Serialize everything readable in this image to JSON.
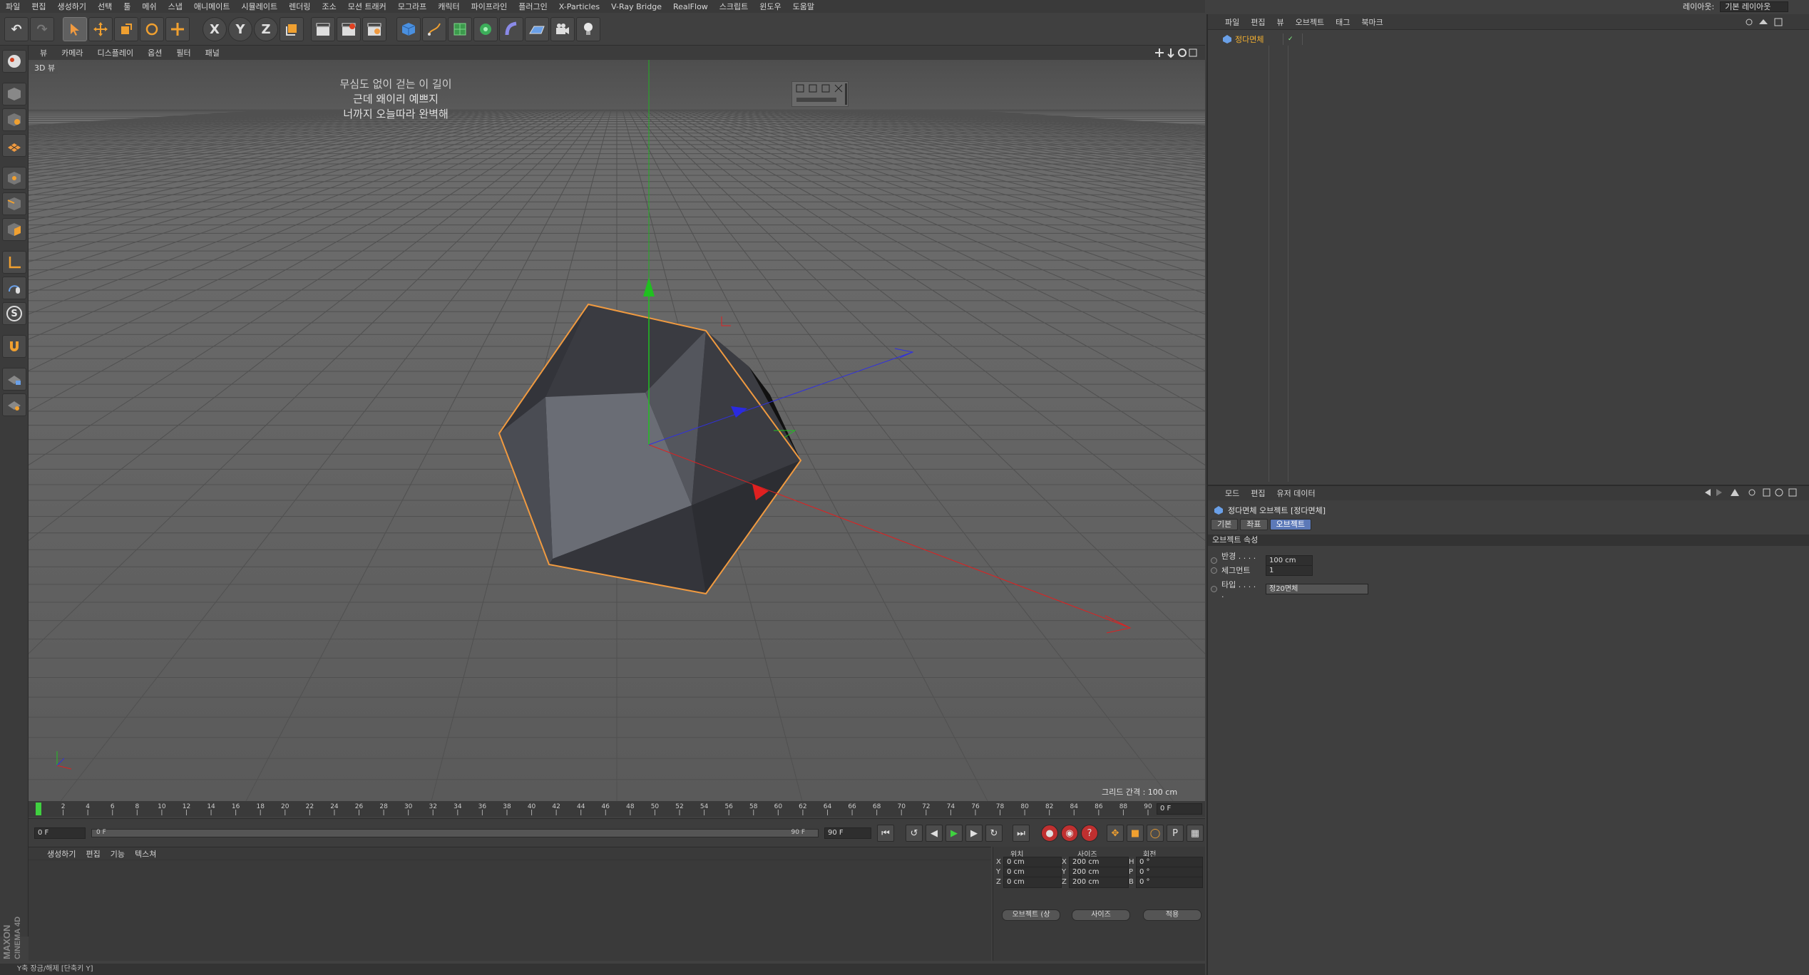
{
  "menubar": [
    "파일",
    "편집",
    "생성하기",
    "선택",
    "툴",
    "메쉬",
    "스냅",
    "애니메이트",
    "시뮬레이트",
    "렌더링",
    "조소",
    "모션 트래커",
    "모그라프",
    "캐릭터",
    "파이프라인",
    "플러그인",
    "X-Particles",
    "V-Ray Bridge",
    "RealFlow",
    "스크립트",
    "윈도우",
    "도움말"
  ],
  "layout": {
    "label": "레이아웃:",
    "value": "기본 레이아웃"
  },
  "toolbar": {
    "x": "X",
    "y": "Y",
    "z": "Z"
  },
  "leftbar": {
    "s": "S"
  },
  "viewport": {
    "menu": [
      "뷰",
      "카메라",
      "디스플레이",
      "옵션",
      "필터",
      "패널"
    ],
    "label": "3D 뷰",
    "lyrics": [
      "무심도 없이 걷는 이 길이",
      "근데 왜이리 예쁘지",
      "너까지 오늘따라 완벽해"
    ],
    "grid_info": "그리드 간격 : 100 cm"
  },
  "timeline": {
    "ticks": [
      "0",
      "2",
      "4",
      "6",
      "8",
      "10",
      "12",
      "14",
      "16",
      "18",
      "20",
      "22",
      "24",
      "26",
      "28",
      "30",
      "32",
      "34",
      "36",
      "38",
      "40",
      "42",
      "44",
      "46",
      "48",
      "50",
      "52",
      "54",
      "56",
      "58",
      "60",
      "62",
      "64",
      "66",
      "68",
      "70",
      "72",
      "74",
      "76",
      "78",
      "80",
      "82",
      "84",
      "86",
      "88",
      "90"
    ],
    "current_frame": "0 F",
    "start": "0 F",
    "slider_start": "0 F",
    "slider_end": "90 F",
    "end": "90 F"
  },
  "material": {
    "menu": [
      "생성하기",
      "편집",
      "기능",
      "텍스쳐"
    ]
  },
  "coords": {
    "headers": [
      "위치",
      "사이즈",
      "회전"
    ],
    "rows": [
      {
        "axis": "X",
        "pos": "0 cm",
        "sax": "X",
        "size": "200 cm",
        "rax": "H",
        "rot": "0 °"
      },
      {
        "axis": "Y",
        "pos": "0 cm",
        "sax": "Y",
        "size": "200 cm",
        "rax": "P",
        "rot": "0 °"
      },
      {
        "axis": "Z",
        "pos": "0 cm",
        "sax": "Z",
        "size": "200 cm",
        "rax": "B",
        "rot": "0 °"
      }
    ],
    "mode_select": "오브젝트 (상",
    "size_select": "사이즈",
    "apply": "적용"
  },
  "status": "Y축 장금/해제 [단축키 Y]",
  "maxon": "MAXON\nCINEMA 4D",
  "objects": {
    "menu": [
      "파일",
      "편집",
      "뷰",
      "오브젝트",
      "태그",
      "북마크"
    ],
    "item": "정다면체"
  },
  "attributes": {
    "menu": [
      "모드",
      "편집",
      "유저 데이터"
    ],
    "title": "정다면체 오브젝트 [정다면체]",
    "tabs": [
      "기본",
      "좌표",
      "오브젝트"
    ],
    "section": "오브젝트 속성",
    "fields": [
      {
        "label": "반경 . . . . .",
        "value": "100 cm"
      },
      {
        "label": "세그먼트",
        "value": "1"
      },
      {
        "label": "타입 . . . . .",
        "value": "정20면체"
      }
    ]
  },
  "colors": {
    "selection": "#f09a40",
    "x_axis": "#e02020",
    "y_axis": "#20c020",
    "z_axis": "#2a2ae0",
    "object_name": "#f4b030",
    "active_tab": "#5c79b8"
  }
}
